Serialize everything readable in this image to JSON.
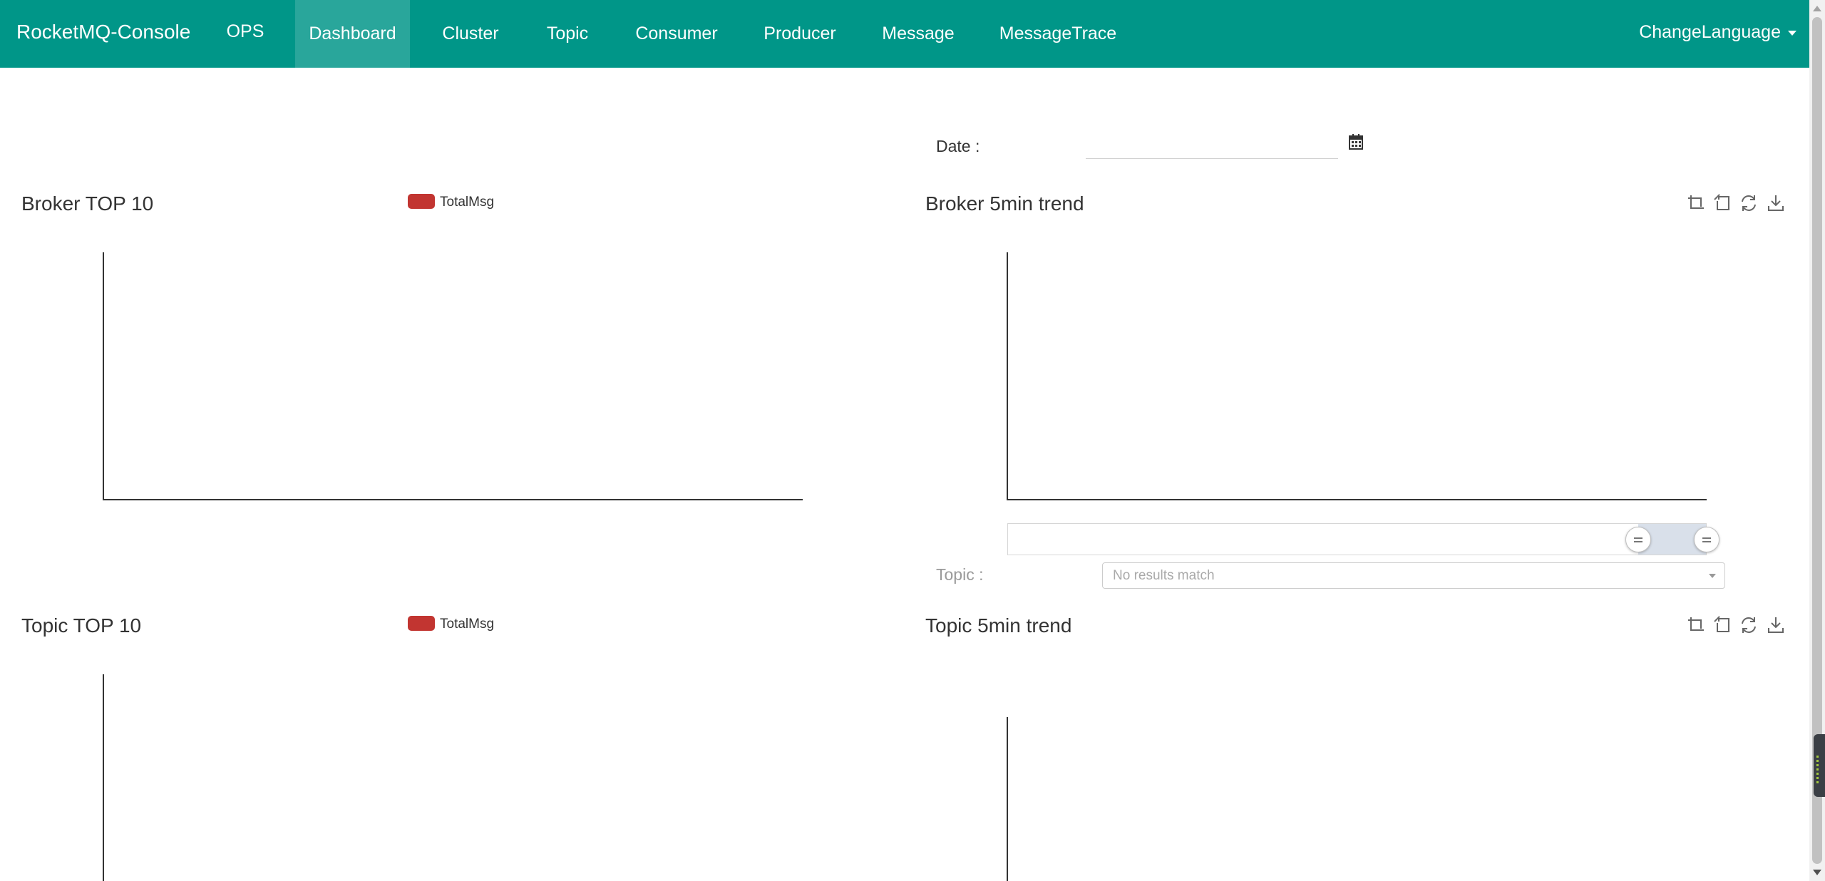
{
  "app": {
    "brand": "RocketMQ-Console"
  },
  "nav": {
    "items": [
      {
        "label": "OPS"
      },
      {
        "label": "Dashboard",
        "active": true
      },
      {
        "label": "Cluster"
      },
      {
        "label": "Topic"
      },
      {
        "label": "Consumer"
      },
      {
        "label": "Producer"
      },
      {
        "label": "Message"
      },
      {
        "label": "MessageTrace"
      }
    ],
    "language": "ChangeLanguage"
  },
  "filters": {
    "date_label": "Date :",
    "date_value": "",
    "topic_label": "Topic :",
    "topic_select_text": "No results match"
  },
  "panels": {
    "broker_top10": {
      "title": "Broker TOP 10",
      "legend": "TotalMsg"
    },
    "broker_trend": {
      "title": "Broker 5min trend"
    },
    "topic_top10": {
      "title": "Topic TOP 10",
      "legend": "TotalMsg"
    },
    "topic_trend": {
      "title": "Topic 5min trend"
    }
  },
  "icons": {
    "toolbox": [
      "zoom-icon",
      "zoom-reset-icon",
      "restore-icon",
      "save-image-icon"
    ],
    "calendar": "calendar-icon"
  },
  "colors": {
    "navbar": "#009688",
    "series": "#c23531",
    "zoom_fill": "#d9e0ea"
  },
  "chart_data": [
    {
      "type": "bar",
      "title": "Broker TOP 10",
      "legend": [
        "TotalMsg"
      ],
      "categories": [],
      "values": []
    },
    {
      "type": "line",
      "title": "Broker 5min trend",
      "x": [],
      "series": []
    },
    {
      "type": "bar",
      "title": "Topic TOP 10",
      "legend": [
        "TotalMsg"
      ],
      "categories": [],
      "values": []
    },
    {
      "type": "line",
      "title": "Topic 5min trend",
      "x": [],
      "series": []
    }
  ]
}
